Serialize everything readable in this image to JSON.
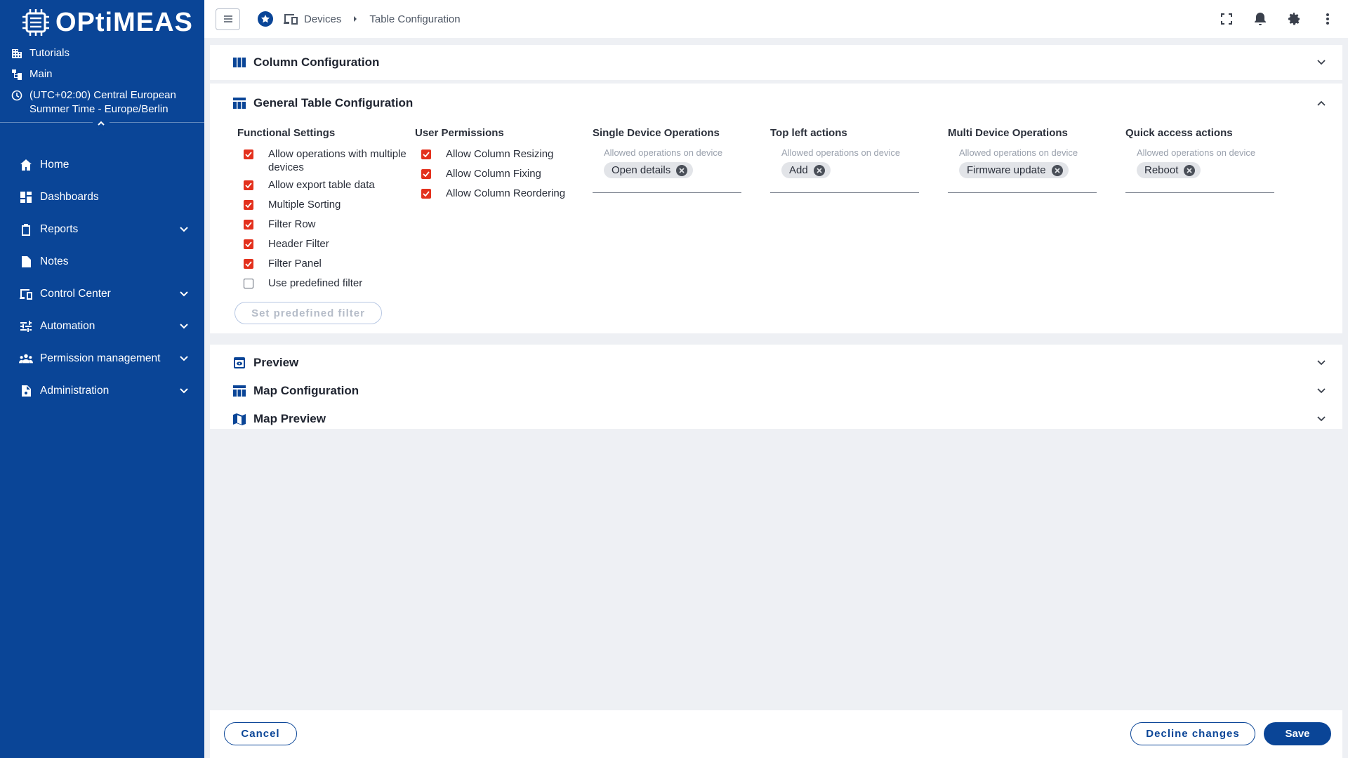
{
  "sidebar": {
    "logo_text": "OPtiMEAS",
    "tenant": [
      {
        "icon": "building-icon",
        "label": "Tutorials"
      },
      {
        "icon": "hierarchy-icon",
        "label": "Main"
      },
      {
        "icon": "clock-icon",
        "label": "(UTC+02:00) Central European Summer Time - Europe/Berlin"
      }
    ],
    "nav": [
      {
        "icon": "home-icon",
        "label": "Home",
        "expandable": false
      },
      {
        "icon": "dashboard-icon",
        "label": "Dashboards",
        "expandable": false
      },
      {
        "icon": "clipboard-icon",
        "label": "Reports",
        "expandable": true
      },
      {
        "icon": "note-icon",
        "label": "Notes",
        "expandable": false
      },
      {
        "icon": "devices-icon",
        "label": "Control Center",
        "expandable": true
      },
      {
        "icon": "sliders-icon",
        "label": "Automation",
        "expandable": true
      },
      {
        "icon": "people-icon",
        "label": "Permission management",
        "expandable": true
      },
      {
        "icon": "admin-doc-icon",
        "label": "Administration",
        "expandable": true
      }
    ]
  },
  "topbar": {
    "breadcrumb": [
      "Devices",
      "Table Configuration"
    ]
  },
  "panels": {
    "column_config": "Column Configuration",
    "general_config": "General Table Configuration",
    "preview": "Preview",
    "map_config": "Map Configuration",
    "map_preview": "Map Preview"
  },
  "functional": {
    "title": "Functional Settings",
    "items": [
      {
        "label": "Allow operations with multiple devices",
        "checked": true
      },
      {
        "label": "Allow export table data",
        "checked": true
      },
      {
        "label": "Multiple Sorting",
        "checked": true
      },
      {
        "label": "Filter Row",
        "checked": true
      },
      {
        "label": "Header Filter",
        "checked": true
      },
      {
        "label": "Filter Panel",
        "checked": true
      },
      {
        "label": "Use predefined filter",
        "checked": false
      }
    ],
    "predefined_button": "Set predefined filter"
  },
  "permissions": {
    "title": "User Permissions",
    "items": [
      {
        "label": "Allow Column Resizing",
        "checked": true
      },
      {
        "label": "Allow Column Fixing",
        "checked": true
      },
      {
        "label": "Allow Column Reordering",
        "checked": true
      }
    ]
  },
  "tag_columns": [
    {
      "title": "Single Device Operations",
      "placeholder": "Allowed operations on device",
      "chips": [
        "Open details"
      ]
    },
    {
      "title": "Top left actions",
      "placeholder": "Allowed operations on device",
      "chips": [
        "Add"
      ]
    },
    {
      "title": "Multi Device Operations",
      "placeholder": "Allowed operations on device",
      "chips": [
        "Firmware update"
      ]
    },
    {
      "title": "Quick access actions",
      "placeholder": "Allowed operations on device",
      "chips": [
        "Reboot"
      ]
    }
  ],
  "footer": {
    "cancel": "Cancel",
    "decline": "Decline changes",
    "save": "Save"
  },
  "colors": {
    "brand": "#0a4597",
    "checkbox_checked": "#e3311d"
  }
}
